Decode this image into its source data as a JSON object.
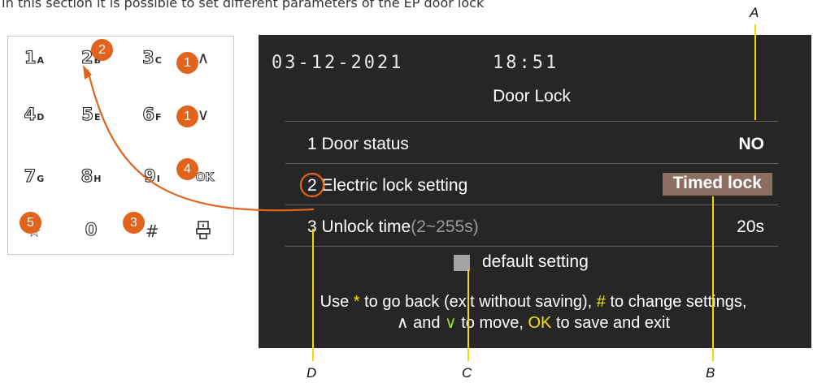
{
  "intro": "In this section it is possible to set different parameters of the EP door lock",
  "keypad": {
    "keys": [
      {
        "num": "1",
        "let": "A"
      },
      {
        "num": "2",
        "let": "B"
      },
      {
        "num": "3",
        "let": "C"
      },
      {
        "num": "4",
        "let": "D"
      },
      {
        "num": "5",
        "let": "E"
      },
      {
        "num": "6",
        "let": "F"
      },
      {
        "num": "7",
        "let": "G"
      },
      {
        "num": "8",
        "let": "H"
      },
      {
        "num": "9",
        "let": "I"
      },
      {
        "num": "0",
        "let": ""
      }
    ],
    "ok_label": "OK",
    "badges": [
      "1",
      "2",
      "1",
      "4",
      "5",
      "3"
    ]
  },
  "screen": {
    "date": "03-12-2021",
    "time": "18:51",
    "title": "Door Lock",
    "rows": [
      {
        "label": "1 Door status",
        "value": "NO"
      },
      {
        "label": "Electric lock setting",
        "number": "2",
        "value": "Timed lock"
      },
      {
        "label": "3 Unlock time",
        "range": "(2~255s)",
        "value": "20s"
      }
    ],
    "default_setting": "default setting",
    "hint": {
      "p1": "Use ",
      "star": "*",
      "p2": " to go back (exit without saving), ",
      "hash": "#",
      "p3": " to change settings,",
      "up": "∧",
      "p4": " and ",
      "down": "∨",
      "p5": " to move, ",
      "ok": "OK",
      "p6": " to save and exit"
    }
  },
  "callouts": {
    "a": "A",
    "b": "B",
    "c": "C",
    "d": "D"
  },
  "colors": {
    "badge": "#e2631b",
    "screen_bg": "#262626",
    "highlight": "#8d6d62",
    "hint_yellow": "#f3e600",
    "hint_green": "#8fe21e"
  }
}
